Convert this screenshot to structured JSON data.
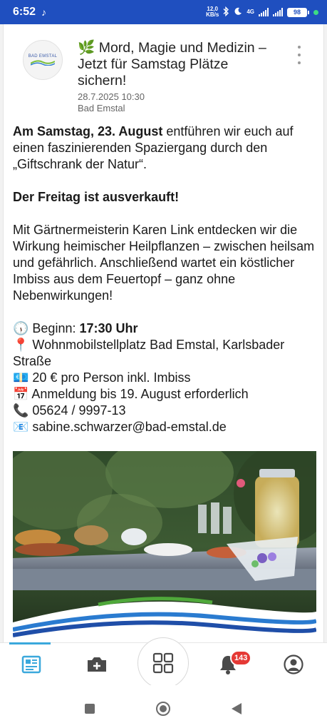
{
  "status_bar": {
    "time": "6:52",
    "net_speed_value": "12,0",
    "net_speed_unit": "KB/s",
    "network_type": "4G",
    "battery": "98"
  },
  "post": {
    "title": "🌿 Mord, Magie und Medizin – Jetzt für Samstag Plätze sichern!",
    "date": "28.7.2025 10:30",
    "author": "Bad Emstal",
    "avatar_logo_text": "BAD EMSTAL",
    "body": {
      "p1_bold": "Am Samstag, 23. August",
      "p1_rest": " entführen wir euch auf einen faszinierenden Spaziergang durch den „Giftschrank der Natur“.",
      "p2_bold": "Der Freitag ist ausverkauft!",
      "p3": "Mit Gärtnermeisterin Karen Link entdecken wir die Wirkung heimischer Heilpflanzen – zwischen heilsam und gefährlich. Anschließend wartet ein köstlicher Imbiss aus dem Feuertopf – ganz ohne Nebenwirkungen!",
      "begin_prefix": "🕠 Beginn: ",
      "begin_time": "17:30 Uhr",
      "location": "📍 Wohnmobilstellplatz Bad Emstal, Karlsbader Straße",
      "price": "💶 20 € pro Person inkl. Imbiss",
      "registration": "📅 Anmeldung bis 19. August erforderlich",
      "phone": "📞 05624 / 9997-13",
      "email": "📧 sabine.schwarzer@bad-emstal.de"
    }
  },
  "bottom_nav": {
    "items": [
      "news-icon",
      "camera-plus-icon",
      "grid-icon",
      "bell-icon",
      "profile-icon"
    ],
    "notification_count": "143"
  },
  "colors": {
    "status_bar": "#1f4fbf",
    "accent": "#3aa8dc",
    "badge": "#e53935"
  }
}
